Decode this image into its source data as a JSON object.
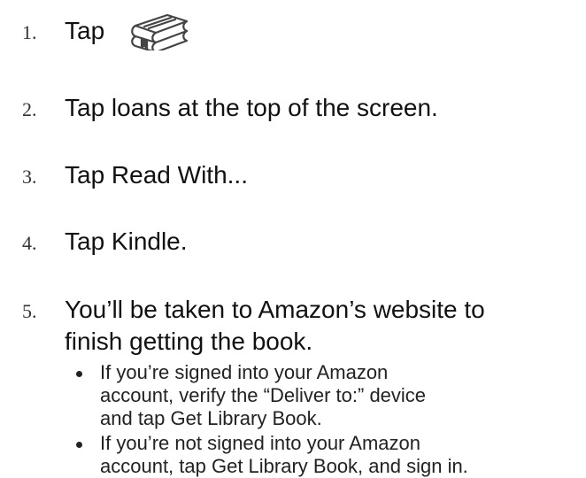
{
  "steps": [
    {
      "number": "1.",
      "text": "Tap",
      "icon": "book-stack-icon"
    },
    {
      "number": "2.",
      "text": "Tap loans at the top of the screen."
    },
    {
      "number": "3.",
      "text": "Tap Read With..."
    },
    {
      "number": "4.",
      "text": "Tap Kindle."
    },
    {
      "number": "5.",
      "lines": [
        "You’ll be taken to Amazon’s website to",
        "finish getting the book."
      ]
    }
  ],
  "bullets": [
    {
      "lines": [
        "If you’re signed into your Amazon",
        "account, verify the “Deliver to:” device",
        "and tap Get Library Book."
      ]
    },
    {
      "lines": [
        "If you’re not signed into your Amazon",
        "account, tap Get Library Book, and sign in."
      ]
    }
  ],
  "colors": {
    "text": "#111111",
    "number": "#333333",
    "icon_stroke": "#444444",
    "background": "#ffffff"
  }
}
